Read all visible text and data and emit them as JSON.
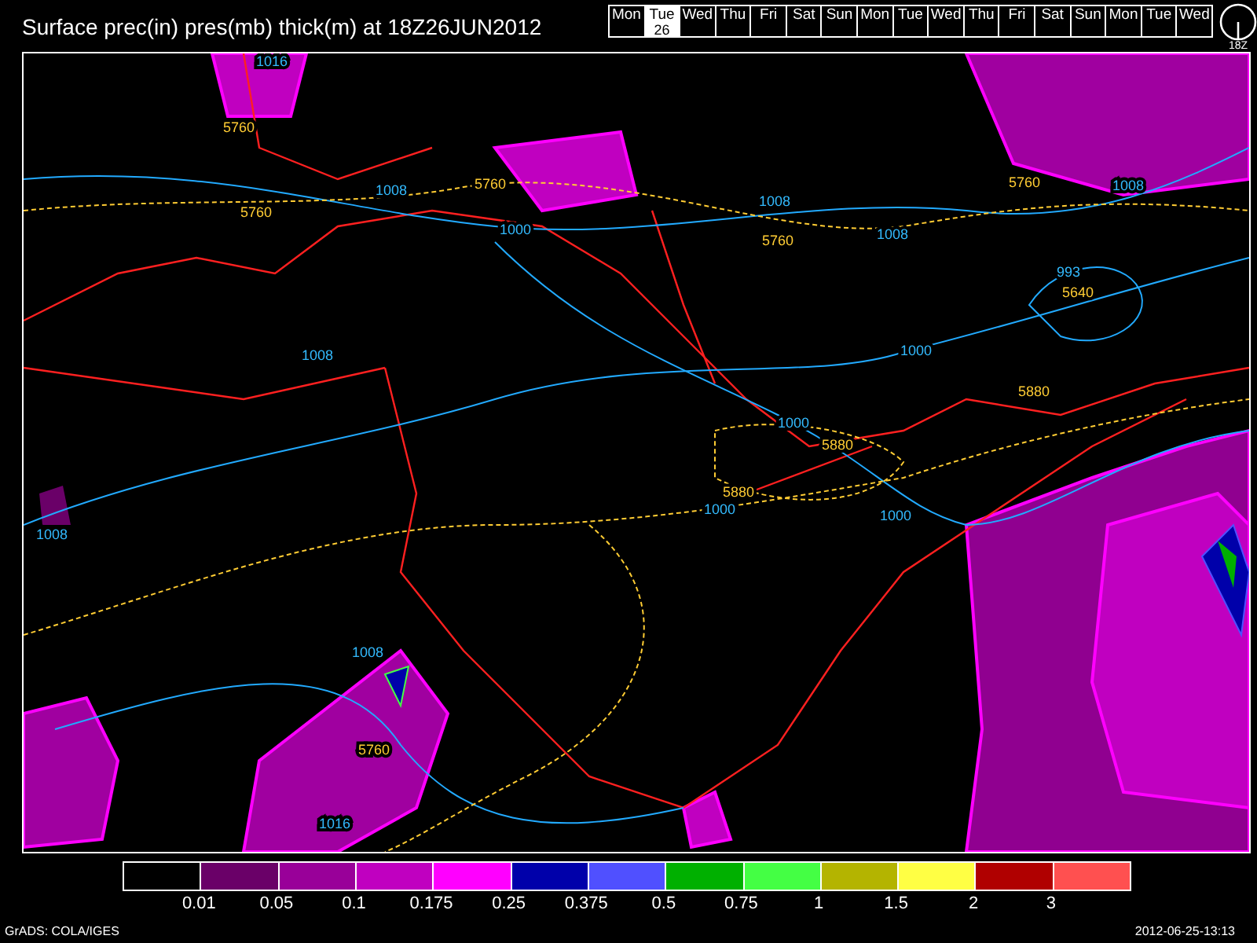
{
  "title": "Surface prec(in) pres(mb) thick(m) at 18Z26JUN2012",
  "days": [
    {
      "label": "Mon",
      "selected": false
    },
    {
      "label": "Tue",
      "date": "26",
      "selected": true
    },
    {
      "label": "Wed",
      "selected": false
    },
    {
      "label": "Thu",
      "selected": false
    },
    {
      "label": "Fri",
      "selected": false
    },
    {
      "label": "Sat",
      "selected": false
    },
    {
      "label": "Sun",
      "selected": false
    },
    {
      "label": "Mon",
      "selected": false
    },
    {
      "label": "Tue",
      "selected": false
    },
    {
      "label": "Wed",
      "selected": false
    },
    {
      "label": "Thu",
      "selected": false
    },
    {
      "label": "Fri",
      "selected": false
    },
    {
      "label": "Sat",
      "selected": false
    },
    {
      "label": "Sun",
      "selected": false
    },
    {
      "label": "Mon",
      "selected": false
    },
    {
      "label": "Tue",
      "selected": false
    },
    {
      "label": "Wed",
      "selected": false
    }
  ],
  "clock": {
    "label": "18Z"
  },
  "contour_labels": [
    {
      "text": "1016",
      "kind": "pressure"
    },
    {
      "text": "5760",
      "kind": "thickness"
    },
    {
      "text": "5760",
      "kind": "thickness"
    },
    {
      "text": "5760",
      "kind": "thickness"
    },
    {
      "text": "1008",
      "kind": "pressure"
    },
    {
      "text": "1008",
      "kind": "pressure"
    },
    {
      "text": "1000",
      "kind": "pressure"
    },
    {
      "text": "5760",
      "kind": "thickness"
    },
    {
      "text": "1008",
      "kind": "pressure"
    },
    {
      "text": "5760",
      "kind": "thickness"
    },
    {
      "text": "1008",
      "kind": "pressure"
    },
    {
      "text": "993",
      "kind": "pressure"
    },
    {
      "text": "5640",
      "kind": "thickness"
    },
    {
      "text": "1008",
      "kind": "pressure"
    },
    {
      "text": "1000",
      "kind": "pressure"
    },
    {
      "text": "5880",
      "kind": "thickness"
    },
    {
      "text": "1000",
      "kind": "pressure"
    },
    {
      "text": "5880",
      "kind": "thickness"
    },
    {
      "text": "5880",
      "kind": "thickness"
    },
    {
      "text": "1000",
      "kind": "pressure"
    },
    {
      "text": "1000",
      "kind": "pressure"
    },
    {
      "text": "1008",
      "kind": "pressure"
    },
    {
      "text": "1008",
      "kind": "pressure"
    },
    {
      "text": "5760",
      "kind": "thickness"
    },
    {
      "text": "1016",
      "kind": "pressure"
    }
  ],
  "legend": {
    "swatches": [
      {
        "color": "#000000"
      },
      {
        "color": "#6a0068"
      },
      {
        "color": "#990099"
      },
      {
        "color": "#c000c0"
      },
      {
        "color": "#ff00ff"
      },
      {
        "color": "#0000aa"
      },
      {
        "color": "#5050ff"
      },
      {
        "color": "#00b000"
      },
      {
        "color": "#44ff44"
      },
      {
        "color": "#b4b400"
      },
      {
        "color": "#ffff44"
      },
      {
        "color": "#b00000"
      },
      {
        "color": "#ff5050"
      }
    ],
    "labels": [
      "0.01",
      "0.05",
      "0.1",
      "0.175",
      "0.25",
      "0.375",
      "0.5",
      "0.75",
      "1",
      "1.5",
      "2",
      "3"
    ]
  },
  "footer": {
    "credit": "GrADS: COLA/IGES",
    "timestamp": "2012-06-25-13:13"
  }
}
